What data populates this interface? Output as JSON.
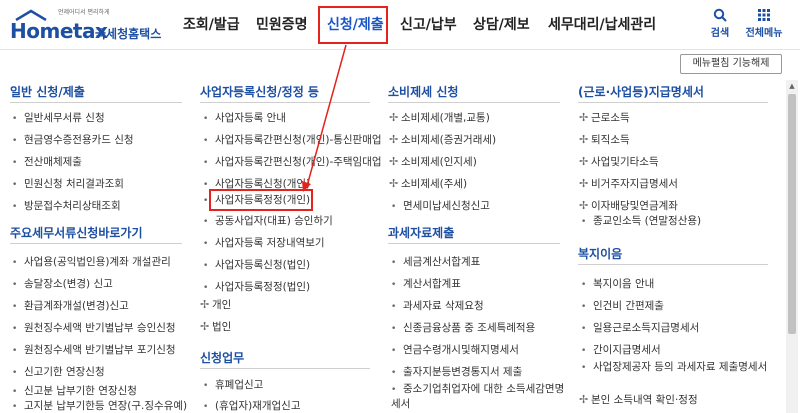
{
  "logo": {
    "sub": "언제어디서 편리하게",
    "main": "Hometax",
    "name": "국세청홈택스"
  },
  "gnb": [
    "조회/발급",
    "민원증명",
    "신청/제출",
    "신고/납부",
    "상담/제보",
    "세무대리/납세관리"
  ],
  "util": {
    "search": "검색",
    "all_menu": "전체메뉴"
  },
  "menu_map_button": "메뉴펼침 기능해제",
  "col1": {
    "sec1": {
      "title": "일반 신청/제출",
      "items": [
        "일반세무서류 신청",
        "현금영수증전용카드 신청",
        "전산매체제출",
        "민원신청 처리결과조회",
        "방문접수처리상태조회"
      ]
    },
    "sec2": {
      "title": "주요세무서류신청바로가기",
      "items": [
        "사업용(공익법인용)계좌 개설관리",
        "송달장소(변경) 신고",
        "환급계좌개설(변경)신고",
        "원천징수세액 반기별납부 승인신청",
        "원천징수세액 반기별납부 포기신청",
        "신고기한 연장신청",
        "신고분 납부기한 연장신청",
        "고지분 납부기한등 연장(구.징수유예)"
      ]
    }
  },
  "col2": {
    "sec1": {
      "title": "사업자등록신청/정정 등",
      "items": [
        "사업자등록 안내",
        "사업자등록간편신청(개인)-통신판매업",
        "사업자등록간편신청(개인)-주택임대업",
        "사업자등록신청(개인)",
        "사업자등록정정(개인)",
        "공동사업자(대표) 승인하기",
        "사업자등록 저장내역보기",
        "사업자등록신청(법인)",
        "사업자등록정정(법인)"
      ],
      "expand": [
        "개인",
        "법인"
      ]
    },
    "sec2": {
      "title": "신청업무",
      "items": [
        "휴폐업신고",
        "(휴업자)재개업신고"
      ]
    }
  },
  "col3": {
    "sec1": {
      "title": "소비제세 신청",
      "items": [
        "소비제세(개별,교통)",
        "소비제세(증권거래세)",
        "소비제세(인지세)",
        "소비제세(주세)",
        "면세미납세신청신고"
      ]
    },
    "sec2": {
      "title": "과세자료제출",
      "items": [
        "세금계산서합계표",
        "계산서합계표",
        "과세자료 삭제요청",
        "신종금융상품 중 조세특례적용",
        "연금수령개시및해지명세서",
        "출자지분등변경통지서 제출"
      ],
      "wrap_item": "중소기업취업자에 대한 소득세감면명세서"
    }
  },
  "col4": {
    "sec1": {
      "title": "(근로·사업등)지급명세서",
      "items": [
        "근로소득",
        "퇴직소득",
        "사업및기타소득",
        "비거주자지급명세서",
        "이자배당및연금계좌",
        "종교인소득 (연말정산용)"
      ]
    },
    "sec2": {
      "title": "복지이음",
      "items": [
        "복지이음 안내",
        "인건비 간편제출",
        "일용근로소득지급명세서",
        "간이지급명세서"
      ],
      "wrap_item": "사업장제공자 등의 과세자료 제출명세서",
      "last": "본인 소득내역 확인·정정"
    }
  },
  "colors": {
    "accent": "#1d4fa3",
    "highlight": "#e3231c",
    "active": "#1a56c8"
  }
}
